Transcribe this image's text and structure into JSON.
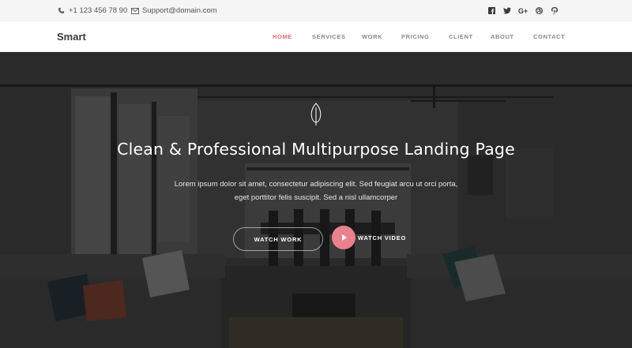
{
  "topbar": {
    "phone": "+1 123 456 78 90",
    "email": "Support@domain.com",
    "socials": [
      {
        "icon": "facebook-icon",
        "glyph": "f"
      },
      {
        "icon": "twitter-icon",
        "glyph": "t"
      },
      {
        "icon": "google-plus-icon",
        "glyph": "G+"
      },
      {
        "icon": "dribbble-icon",
        "glyph": "⊛"
      },
      {
        "icon": "pinterest-icon",
        "glyph": "p"
      }
    ]
  },
  "nav": {
    "logo": "Smart",
    "items": [
      "HOME",
      "SERVICES",
      "WORK",
      "PRICING",
      "CLIENT",
      "ABOUT",
      "CONTACT"
    ],
    "active": "HOME"
  },
  "hero": {
    "headline": "Clean & Professional Multipurpose Landing Page",
    "subtext_line1": "Lorem ipsum dolor sit amet, consectetur adipiscing elit. Sed feugiat arcu ut orci porta,",
    "subtext_line2": "eget porttitor felis suscipit. Sed a nisl ullamcorper",
    "watch_work": "WATCH WORK",
    "watch_video": "WATCH VIDEO"
  },
  "colors": {
    "accent": "#e46a7a",
    "play_button": "#e9818d",
    "topbar_bg": "#f5f5f5",
    "nav_bg": "#ffffff"
  }
}
